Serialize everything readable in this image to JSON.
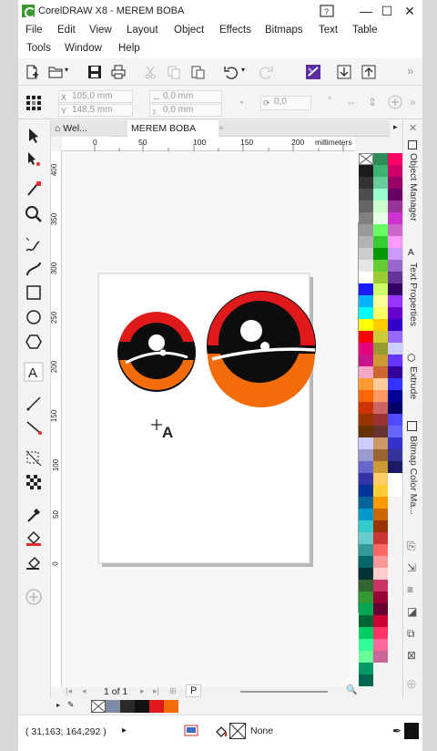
{
  "window": {
    "title": "CorelDRAW X8 - MEREM BOBA",
    "minimize": "—",
    "maximize": "☐",
    "close": "✕"
  },
  "menu": {
    "row1": [
      "File",
      "Edit",
      "View",
      "Layout",
      "Object",
      "Effects",
      "Bitmaps",
      "Text",
      "Table"
    ],
    "row2": [
      "Tools",
      "Window",
      "Help"
    ]
  },
  "toolbar": {
    "more": "»",
    "icons": [
      "new-document-icon",
      "open-folder-icon",
      "save-icon",
      "print-icon",
      "cut-icon",
      "copy-icon",
      "paste-icon",
      "undo-icon",
      "redo-icon",
      "corel-connect-icon",
      "import-icon",
      "export-icon"
    ]
  },
  "property_bar": {
    "x_value": "105,0 mm",
    "y_value": "148,5 mm",
    "w_value": "0,0 mm",
    "h_value": "0,0 mm",
    "angle_value": "0,0",
    "angle_unit": "°"
  },
  "tabs": {
    "welcome": "Wel...",
    "document": "MEREM BOBA",
    "add": "+"
  },
  "ruler": {
    "unit": "millimeters",
    "h_ticks": [
      "0",
      "50",
      "100",
      "150",
      "200"
    ],
    "v_ticks": [
      "400",
      "350",
      "300",
      "250",
      "200",
      "150",
      "100",
      "50",
      "0"
    ]
  },
  "page_nav": {
    "page_of": "1 of 1",
    "page_tab": "P"
  },
  "dockers": [
    "Object Manager",
    "Text Properties",
    "Extrude",
    "Bitmap Color Ma..."
  ],
  "status": {
    "cursor_position": "( 31,163; 164,292 )",
    "play_arrow": "▸",
    "outline_value": "None"
  },
  "colors": {
    "eye_red": "#e01a1a",
    "eye_orange": "#f26d0a",
    "eye_black": "#0d0d0d",
    "accent_purple": "#5a2ea0",
    "doc_palette": [
      "#ffffff",
      "#7a8aa8",
      "#2a2a2a",
      "#111111",
      "#e01a1a",
      "#f26d0a"
    ]
  }
}
